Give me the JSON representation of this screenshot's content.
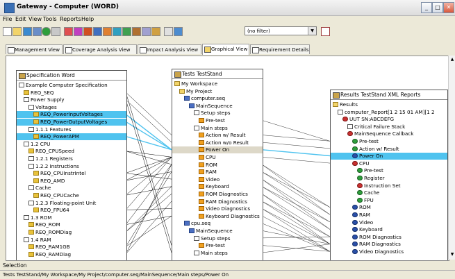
{
  "window": {
    "title": "Gateway - Computer (WORD)",
    "buttons": [
      "_",
      "□",
      "✕"
    ]
  },
  "menu": [
    "File",
    "Edit",
    "View",
    "Tools",
    "Reports",
    "Help"
  ],
  "toolbar": {
    "filter_value": "(no filter)"
  },
  "tabs": [
    {
      "label": "Management View",
      "active": false
    },
    {
      "label": "Coverage Analysis View",
      "active": false
    },
    {
      "label": "Impact Analysis View",
      "active": false
    },
    {
      "label": "Graphical View",
      "active": true
    },
    {
      "label": "Requirement Details",
      "active": false
    }
  ],
  "spec_panel": {
    "title": "Specification   Word",
    "rows": [
      {
        "text": "Example Computer Specification",
        "icon": "doc",
        "indent": 0
      },
      {
        "text": "REQ_SEQ",
        "icon": "req",
        "indent": 1
      },
      {
        "text": "Power Supply",
        "icon": "doc",
        "indent": 1
      },
      {
        "text": "Voltages",
        "icon": "doc",
        "indent": 2
      },
      {
        "text": "REQ_PowerInputVoltages",
        "icon": "req",
        "indent": 3,
        "hl": true
      },
      {
        "text": "REQ_PowerOutputVoltages",
        "icon": "req",
        "indent": 3,
        "hl": true
      },
      {
        "text": "1.1.1 Features",
        "icon": "doc",
        "indent": 2
      },
      {
        "text": "REQ_PowerAPM",
        "icon": "req",
        "indent": 3,
        "hl": true
      },
      {
        "text": "1.2 CPU",
        "icon": "doc",
        "indent": 1
      },
      {
        "text": "REQ_CPUSpeed",
        "icon": "req",
        "indent": 2
      },
      {
        "text": "1.2.1 Registers",
        "icon": "doc",
        "indent": 2
      },
      {
        "text": "1.2.2 Instructions",
        "icon": "doc",
        "indent": 2
      },
      {
        "text": "REQ_CPUInstrIntel",
        "icon": "req",
        "indent": 3
      },
      {
        "text": "REQ_AMD",
        "icon": "req",
        "indent": 3
      },
      {
        "text": "Cache",
        "icon": "doc",
        "indent": 2
      },
      {
        "text": "REQ_CPUCache",
        "icon": "req",
        "indent": 3
      },
      {
        "text": "1.2.3 Floating-point Unit",
        "icon": "doc",
        "indent": 2
      },
      {
        "text": "REQ_FPU64",
        "icon": "req",
        "indent": 3
      },
      {
        "text": "1.3 ROM",
        "icon": "doc",
        "indent": 1
      },
      {
        "text": "REQ_ROM",
        "icon": "req",
        "indent": 2
      },
      {
        "text": "REQ_ROMDiag",
        "icon": "req",
        "indent": 2
      },
      {
        "text": "1.4 RAM",
        "icon": "doc",
        "indent": 1
      },
      {
        "text": "REQ_RAM1GB",
        "icon": "req",
        "indent": 2
      },
      {
        "text": "REQ_RAMDiag",
        "icon": "req",
        "indent": 2
      }
    ]
  },
  "tests_panel": {
    "title": "Tests   TestStand",
    "rows": [
      {
        "text": "My Workspace",
        "icon": "folder",
        "indent": 0
      },
      {
        "text": "My Project",
        "icon": "folder",
        "indent": 1
      },
      {
        "text": "computer.seq",
        "icon": "seq",
        "indent": 2
      },
      {
        "text": "MainSequence",
        "icon": "seq",
        "indent": 3
      },
      {
        "text": "Setup steps",
        "icon": "doc",
        "indent": 4
      },
      {
        "text": "Pre-test",
        "icon": "step",
        "indent": 5
      },
      {
        "text": "Main steps",
        "icon": "doc",
        "indent": 4
      },
      {
        "text": "Action w/ Result",
        "icon": "step",
        "indent": 5
      },
      {
        "text": "Action w/o Result",
        "icon": "step",
        "indent": 5
      },
      {
        "text": "Power On",
        "icon": "step",
        "indent": 5,
        "sel": true
      },
      {
        "text": "CPU",
        "icon": "step",
        "indent": 5
      },
      {
        "text": "ROM",
        "icon": "step",
        "indent": 5
      },
      {
        "text": "RAM",
        "icon": "step",
        "indent": 5
      },
      {
        "text": "Video",
        "icon": "step",
        "indent": 5
      },
      {
        "text": "Keyboard",
        "icon": "step",
        "indent": 5
      },
      {
        "text": "ROM Diagnostics",
        "icon": "step",
        "indent": 5
      },
      {
        "text": "RAM Diagnostics",
        "icon": "step",
        "indent": 5
      },
      {
        "text": "Video Diagnostics",
        "icon": "step",
        "indent": 5
      },
      {
        "text": "Keyboard Diagnostics",
        "icon": "step",
        "indent": 5
      },
      {
        "text": "cpu.seq",
        "icon": "seq",
        "indent": 2
      },
      {
        "text": "MainSequence",
        "icon": "seq",
        "indent": 3
      },
      {
        "text": "Setup steps",
        "icon": "doc",
        "indent": 4
      },
      {
        "text": "Pre-test",
        "icon": "step",
        "indent": 5
      },
      {
        "text": "Main steps",
        "icon": "doc",
        "indent": 4
      }
    ]
  },
  "results_panel": {
    "title": "Results   TestStand XML Reports",
    "rows": [
      {
        "text": "Results",
        "icon": "folder",
        "indent": 0
      },
      {
        "text": "computer_Report[1 2 15 01 AM][1 2",
        "icon": "doc",
        "indent": 1
      },
      {
        "text": "UUT SN:ABCDEFG",
        "icon": "red",
        "indent": 2
      },
      {
        "text": "Critical Failure Stack",
        "icon": "doc",
        "indent": 3
      },
      {
        "text": "MainSequence Callback",
        "icon": "red",
        "indent": 3
      },
      {
        "text": "Pre-test",
        "icon": "green",
        "indent": 4
      },
      {
        "text": "Action w/ Result",
        "icon": "green",
        "indent": 4
      },
      {
        "text": "Power On",
        "icon": "blue",
        "indent": 4,
        "hl": true
      },
      {
        "text": "CPU",
        "icon": "red",
        "indent": 4
      },
      {
        "text": "Pre-test",
        "icon": "green",
        "indent": 5
      },
      {
        "text": "Register",
        "icon": "green",
        "indent": 5
      },
      {
        "text": "Instruction Set",
        "icon": "red",
        "indent": 5
      },
      {
        "text": "Cache",
        "icon": "green",
        "indent": 5
      },
      {
        "text": "FPU",
        "icon": "green",
        "indent": 5
      },
      {
        "text": "ROM",
        "icon": "blue",
        "indent": 4
      },
      {
        "text": "RAM",
        "icon": "blue",
        "indent": 4
      },
      {
        "text": "Video",
        "icon": "blue",
        "indent": 4
      },
      {
        "text": "Keyboard",
        "icon": "blue",
        "indent": 4
      },
      {
        "text": "ROM Diagnostics",
        "icon": "blue",
        "indent": 4
      },
      {
        "text": "RAM Diagnostics",
        "icon": "blue",
        "indent": 4
      },
      {
        "text": "Video Diagnostics",
        "icon": "blue",
        "indent": 4
      }
    ]
  },
  "selection_label": "Selection",
  "status_path": "Tests   TestStand/My Workspace/My Project/computer.seq/MainSequence/Main steps/Power On",
  "colors": {
    "highlight": "#4fc3ef",
    "link": "#000000",
    "accent_link": "#4fc3ef"
  }
}
